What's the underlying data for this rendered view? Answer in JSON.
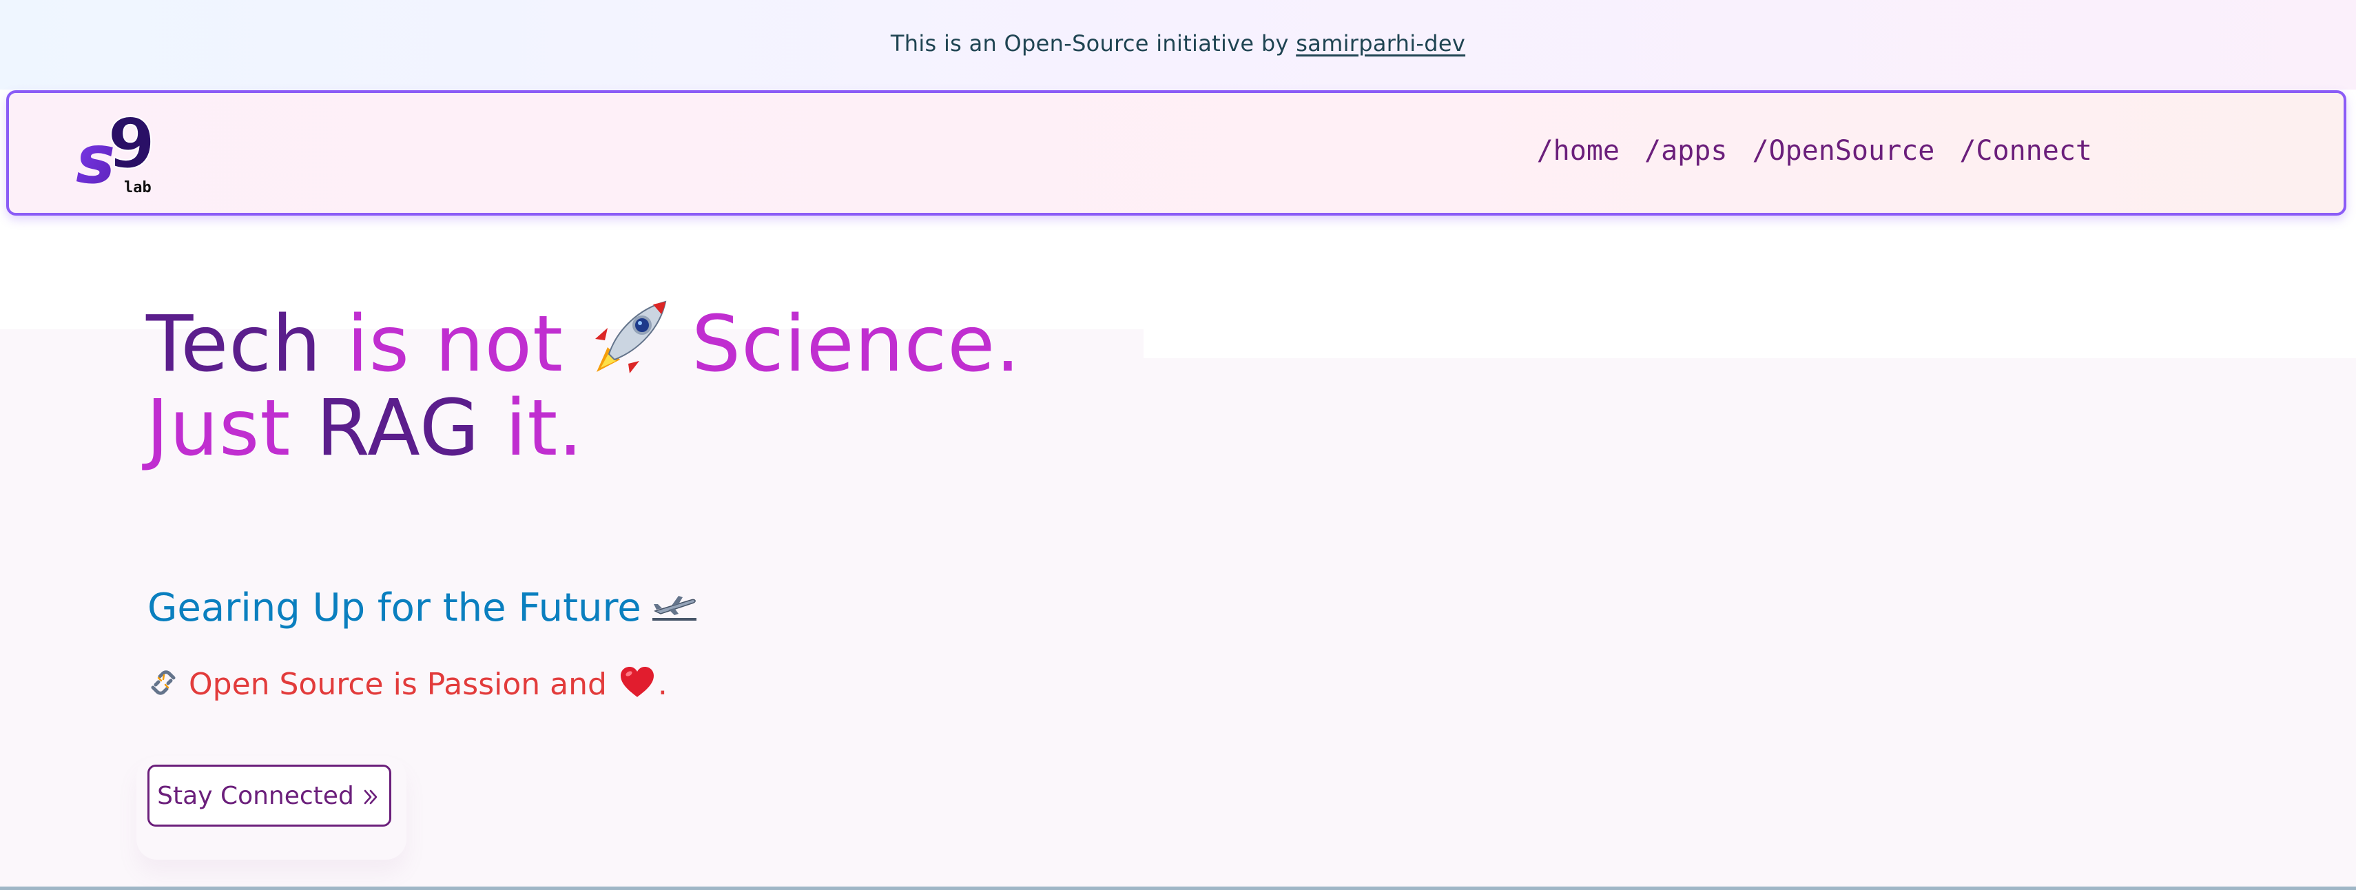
{
  "announcement": {
    "prefix": "This is an Open-Source initiative by ",
    "link_text": "samirparhi-dev"
  },
  "logo": {
    "main": "s9",
    "sub": "lab"
  },
  "nav": {
    "items": [
      "/home",
      "/apps",
      "/OpenSource",
      "/Connect"
    ]
  },
  "hero": {
    "line1": {
      "w1": "Tech",
      "w2": "is not",
      "w3": "Science."
    },
    "line2": {
      "w1": "Just",
      "w2": "RAG",
      "w3": "it."
    },
    "subtitle": "Gearing Up for the Future",
    "tagline_text": "Open Source is Passion and",
    "tagline_end": ".",
    "cta_label": "Stay Connected"
  },
  "icons": {
    "rocket": "rocket-icon",
    "plane": "airplane-departure-icon",
    "chain": "broken-chain-icon",
    "heart": "red-heart-icon",
    "chevron": "double-chevron-right-icon"
  },
  "colors": {
    "accent_purple": "#8b5cf6",
    "headline_dark": "#5b1e8c",
    "headline_pink": "#c02ed0",
    "subtitle_blue": "#0a7fbf",
    "tagline_red": "#e23b3b",
    "nav_text": "#6b1f7b"
  }
}
